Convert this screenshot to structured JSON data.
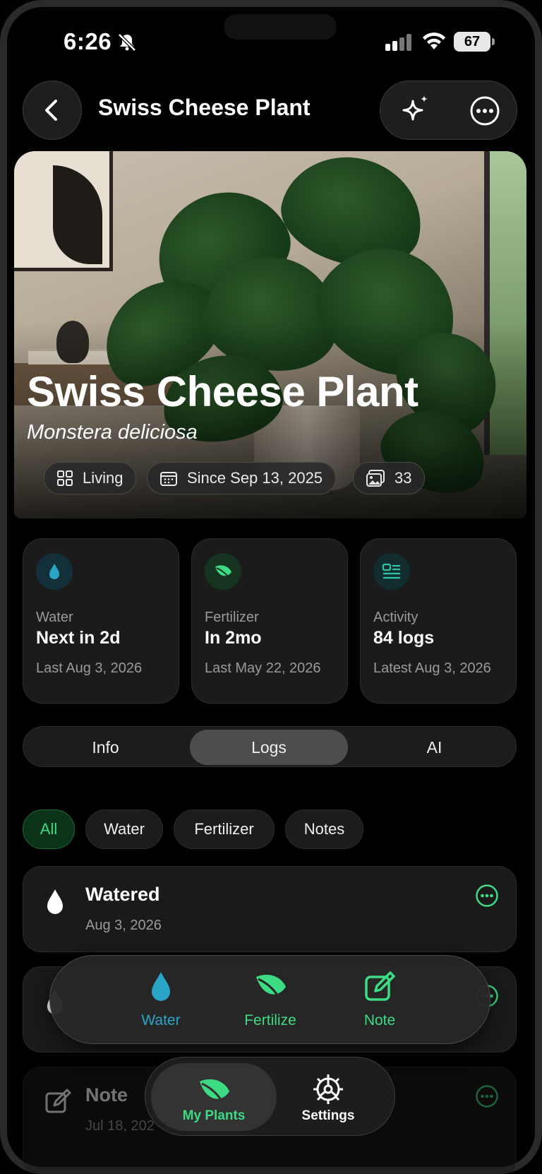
{
  "status_bar": {
    "time": "6:26",
    "battery": "67"
  },
  "header": {
    "title": "Swiss Cheese Plant"
  },
  "hero": {
    "name": "Swiss Cheese Plant",
    "scientific_name": "Monstera deliciosa",
    "chips": [
      {
        "icon": "grid-icon",
        "label": "Living"
      },
      {
        "icon": "calendar-icon",
        "label": "Since Sep 13, 2025"
      },
      {
        "icon": "photos-icon",
        "label": "33"
      }
    ]
  },
  "stats": [
    {
      "icon": "water-drop-icon",
      "title": "Water",
      "value": "Next in 2d",
      "sub": "Last Aug 3, 2026",
      "accent": "#2aa5c7"
    },
    {
      "icon": "leaf-icon",
      "title": "Fertilizer",
      "value": "In 2mo",
      "sub": "Last May 22, 2026",
      "accent": "#3ddc84"
    },
    {
      "icon": "activity-list-icon",
      "title": "Activity",
      "value": "84 logs",
      "sub": "Latest Aug 3, 2026",
      "accent": "#2ec4a6"
    }
  ],
  "segments": {
    "items": [
      "Info",
      "Logs",
      "AI"
    ],
    "selected": "Logs"
  },
  "filters": {
    "items": [
      "All",
      "Water",
      "Fertilizer",
      "Notes"
    ],
    "selected": "All"
  },
  "logs": [
    {
      "icon": "water-drop-icon",
      "title": "Watered",
      "date": "Aug 3, 2026"
    },
    {
      "icon": "water-drop-icon",
      "title": "",
      "date": ""
    },
    {
      "icon": "note-icon",
      "title": "Note",
      "date": "Jul 18, 202"
    }
  ],
  "quick_actions": [
    {
      "icon": "water-drop-icon",
      "label": "Water",
      "color": "#2aa5c7"
    },
    {
      "icon": "leaf-icon",
      "label": "Fertilize",
      "color": "#3ddc84"
    },
    {
      "icon": "note-edit-icon",
      "label": "Note",
      "color": "#3ddc84"
    }
  ],
  "tab_bar": {
    "items": [
      "My Plants",
      "Settings"
    ],
    "selected": "My Plants"
  }
}
